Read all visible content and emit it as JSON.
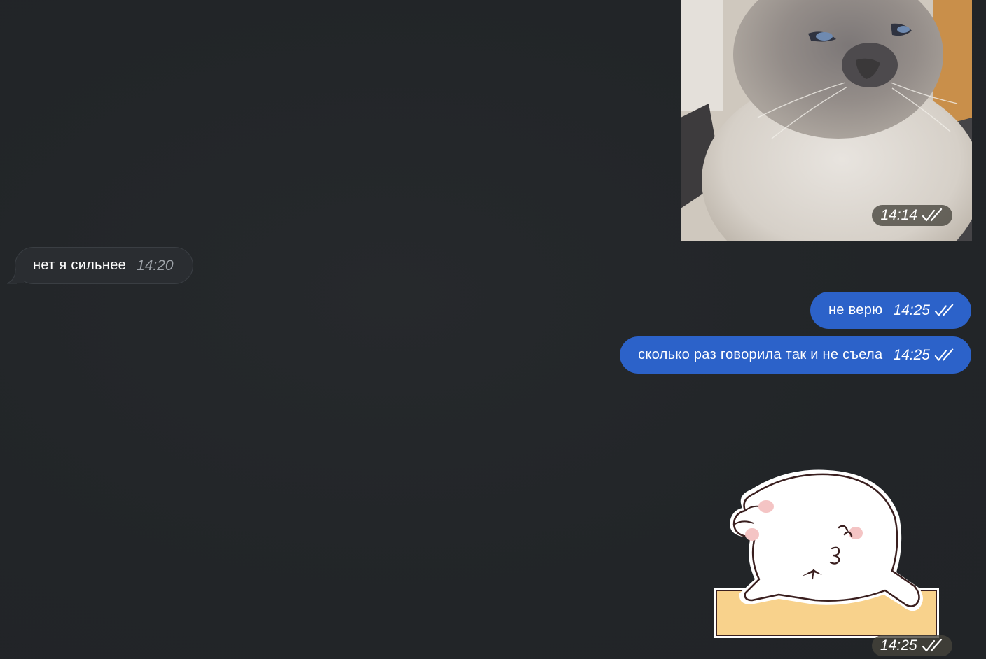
{
  "messages": [
    {
      "kind": "photo",
      "direction": "outgoing",
      "time": "14:14",
      "status_icon": "double-check-icon"
    },
    {
      "kind": "text",
      "direction": "incoming",
      "text": "нет я сильнее",
      "time": "14:20"
    },
    {
      "kind": "text",
      "direction": "outgoing",
      "text": "не верю",
      "time": "14:25",
      "status_icon": "double-check-icon"
    },
    {
      "kind": "text",
      "direction": "outgoing",
      "text": "сколько раз говорила так и не съела",
      "time": "14:25",
      "status_icon": "double-check-icon"
    },
    {
      "kind": "sticker",
      "direction": "outgoing",
      "time": "14:25",
      "status_icon": "double-check-icon"
    }
  ],
  "colors": {
    "background": "#222528",
    "incoming_bubble": "#2a2d31",
    "outgoing_bubble": "#2c62c9"
  }
}
